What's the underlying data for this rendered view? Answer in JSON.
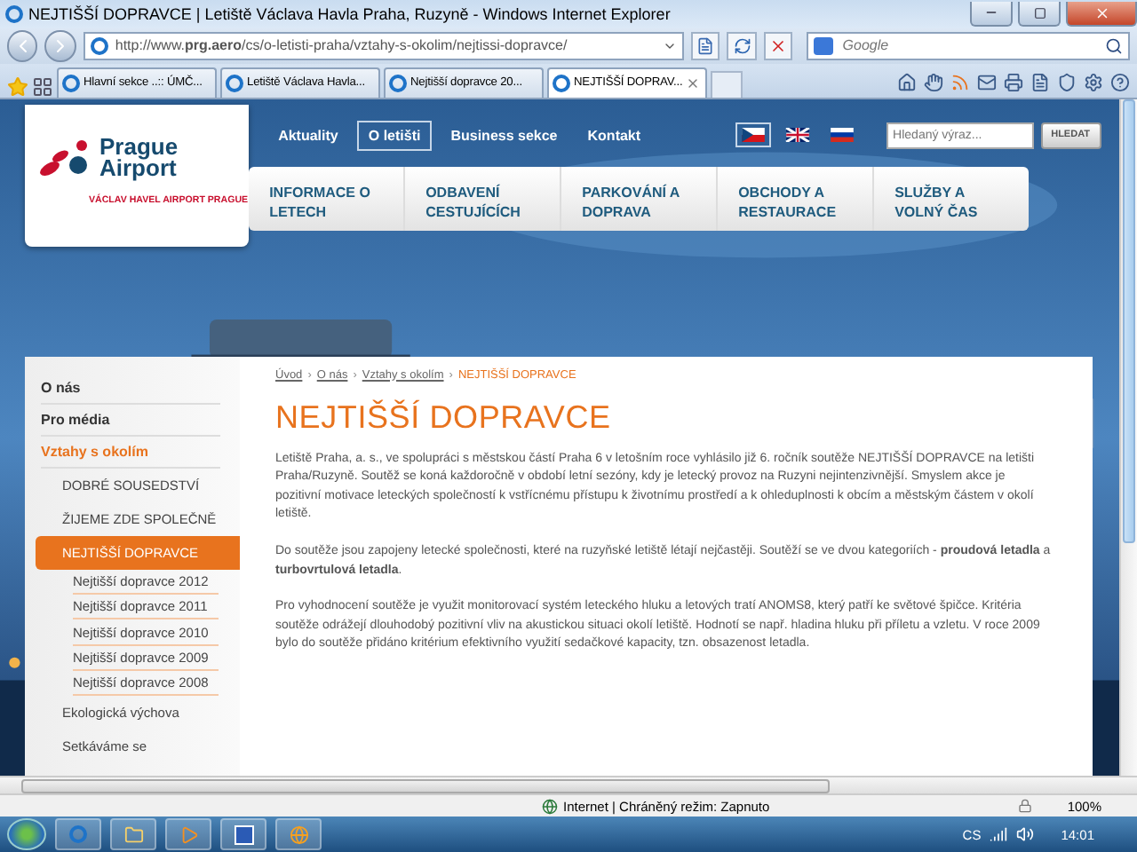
{
  "window": {
    "title": "NEJTIŠŠÍ DOPRAVCE | Letiště Václava Havla Praha, Ruzyně - Windows Internet Explorer"
  },
  "address_bar": {
    "url": "http://www.**prg.aero**/cs/o-letisti-praha/vztahy-s-okolim/nejtissi-dopravce/"
  },
  "search_box": {
    "placeholder": "Google"
  },
  "tabs": [
    {
      "label": "Hlavní sekce ..:: ÚMČ...",
      "selected": false
    },
    {
      "label": "Letiště Václava Havla...",
      "selected": false
    },
    {
      "label": "Nejtišší dopravce 20...",
      "selected": false
    },
    {
      "label": "NEJTIŠŠÍ DOPRAV...",
      "selected": true
    }
  ],
  "site": {
    "logo": {
      "name": "Prague Airport",
      "tagline": "VÁCLAV HAVEL AIRPORT PRAGUE"
    },
    "top_nav": [
      {
        "label": "Aktuality",
        "selected": false
      },
      {
        "label": "O letišti",
        "selected": true
      },
      {
        "label": "Business sekce",
        "selected": false
      },
      {
        "label": "Kontakt",
        "selected": false
      }
    ],
    "languages": [
      {
        "kind": "cz",
        "selected": true
      },
      {
        "kind": "gb",
        "selected": false
      },
      {
        "kind": "ru",
        "selected": false
      }
    ],
    "search": {
      "placeholder": "Hledaný výraz...",
      "button": "HLEDAT"
    },
    "main_menu": [
      "INFORMACE O LETECH",
      "ODBAVENÍ CESTUJÍCÍCH",
      "PARKOVÁNÍ A DOPRAVA",
      "OBCHODY A RESTAURACE",
      "SLUŽBY A VOLNÝ ČAS"
    ],
    "sidebar": [
      {
        "label": "O nás",
        "selected": false
      },
      {
        "label": "Pro média",
        "selected": false
      },
      {
        "label": "Vztahy s okolím",
        "selected": true,
        "children": [
          {
            "label": "DOBRÉ SOUSEDSTVÍ",
            "selected": false
          },
          {
            "label": "ŽIJEME ZDE SPOLEČNĚ",
            "selected": false
          },
          {
            "label": "NEJTIŠŠÍ DOPRAVCE",
            "selected": true,
            "children": [
              {
                "label": "Nejtišší dopravce 2012",
                "selected": false
              },
              {
                "label": "Nejtišší dopravce 2011",
                "selected": false
              },
              {
                "label": "Nejtišší dopravce 2010",
                "selected": false
              },
              {
                "label": "Nejtišší dopravce 2009",
                "selected": false
              },
              {
                "label": "Nejtišší dopravce 2008",
                "selected": false
              }
            ]
          },
          {
            "label": "Ekologická výchova",
            "selected": false
          },
          {
            "label": "Setkáváme se",
            "selected": false
          }
        ]
      }
    ],
    "breadcrumb": {
      "items": [
        {
          "label": "Úvod",
          "current": false
        },
        {
          "label": "O nás",
          "current": false
        },
        {
          "label": "Vztahy s okolím",
          "current": false
        },
        {
          "label": "NEJTIŠŠÍ DOPRAVCE",
          "current": true
        }
      ],
      "separators": [
        "›",
        "›",
        "›"
      ]
    },
    "article": {
      "title": "NEJTIŠŠÍ DOPRAVCE",
      "paragraphs": [
        "Letiště Praha, a. s., ve spolupráci s městskou částí Praha 6 v letošním roce vyhlásilo již 6. ročník soutěže NEJTIŠŠÍ DOPRAVCE na letišti Praha/Ruzyně. Soutěž se koná každoročně v období letní sezóny, kdy je letecký provoz na Ruzyni nejintenzivnější. Smyslem akce je pozitivní motivace leteckých společností k vstřícnému přístupu k životnímu prostředí a k ohleduplnosti k obcím a městským částem v okolí letiště.",
        "Do soutěže jsou zapojeny letecké společnosti, které na ruzyňské letiště létají nejčastěji. Soutěží se ve dvou kategoriích - **proudová letadla** a **turbovrtulová letadla**.",
        "Pro vyhodnocení soutěže je využit monitorovací systém leteckého hluku a letových tratí ANOMS8, který patří ke světové špičce. Kritéria soutěže odrážejí dlouhodobý pozitivní vliv na akustickou situaci okolí letiště. Hodnotí se např. hladina hluku při příletu a vzletu. V roce 2009 bylo do soutěže přidáno kritérium efektivního využití sedačkové kapacity, tzn. obsazenost letadla."
      ]
    }
  },
  "status_bar": {
    "zone": "Internet | Chráněný režim: Zapnuto",
    "zoom": "100%"
  },
  "taskbar": {
    "language": "CS",
    "clock": "14:01"
  }
}
